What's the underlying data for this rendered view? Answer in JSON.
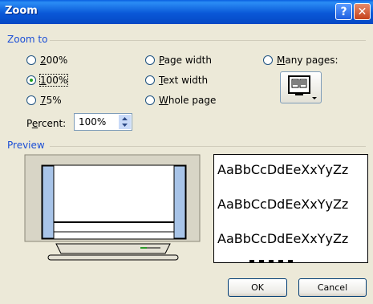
{
  "window": {
    "title": "Zoom",
    "help_glyph": "?",
    "close_glyph": "✕"
  },
  "zoom_to": {
    "label": "Zoom to",
    "options": [
      {
        "key": "200",
        "pre": "",
        "accel": "2",
        "post": "00%",
        "checked": false
      },
      {
        "key": "100",
        "pre": "",
        "accel": "1",
        "post": "00%",
        "checked": true
      },
      {
        "key": "75",
        "pre": "",
        "accel": "7",
        "post": "5%",
        "checked": false
      },
      {
        "key": "page_width",
        "pre": "",
        "accel": "P",
        "post": "age width",
        "checked": false
      },
      {
        "key": "text_width",
        "pre": "",
        "accel": "T",
        "post": "ext width",
        "checked": false
      },
      {
        "key": "whole_page",
        "pre": "",
        "accel": "W",
        "post": "hole page",
        "checked": false
      },
      {
        "key": "many_pages",
        "pre": "",
        "accel": "M",
        "post": "any pages:",
        "checked": false
      }
    ],
    "percent": {
      "pre": "P",
      "accel": "e",
      "post": "rcent:",
      "value": "100%"
    }
  },
  "preview": {
    "label": "Preview",
    "sample_text": [
      "AaBbCcDdEeXxYyZz",
      "AaBbCcDdEeXxYyZz",
      "AaBbCcDdEeXxYyZz"
    ]
  },
  "buttons": {
    "ok": "OK",
    "cancel": "Cancel"
  },
  "colors": {
    "group_label": "#1c4fd6",
    "titlebar": "#0a58d8",
    "dialog_bg": "#ece9d8",
    "radio_dot": "#21a121"
  }
}
